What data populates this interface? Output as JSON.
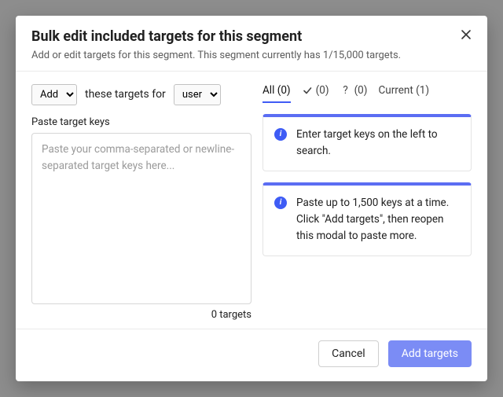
{
  "header": {
    "title": "Bulk edit included targets for this segment",
    "subtitle": "Add or edit targets for this segment. This segment currently has 1/15,000 targets."
  },
  "controls": {
    "action_select": "Add",
    "mid_text": "these targets for",
    "context_select": "user"
  },
  "paste": {
    "label": "Paste target keys",
    "placeholder": "Paste your comma-separated or newline-separated target keys here...",
    "count_text": "0 targets"
  },
  "tabs": {
    "all": {
      "label": "All (0)"
    },
    "check": {
      "count": "(0)"
    },
    "unknown": {
      "count": "(0)"
    },
    "current": {
      "label": "Current (1)"
    }
  },
  "info1": "Enter target keys on the left to search.",
  "info2": "Paste up to 1,500 keys at a time. Click \"Add targets\", then reopen this modal to paste more.",
  "footer": {
    "cancel": "Cancel",
    "primary": "Add targets"
  }
}
